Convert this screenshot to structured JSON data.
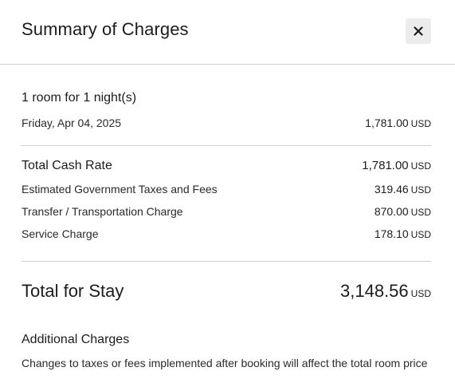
{
  "modal": {
    "title": "Summary of Charges",
    "close_icon": "close-icon"
  },
  "stay": {
    "rooms_nights": "1 room for 1 night(s)",
    "nights": [
      {
        "date": "Friday, Apr 04, 2025",
        "amount": "1,781.00",
        "currency": "USD"
      }
    ]
  },
  "charges": {
    "total_cash_rate": {
      "label": "Total Cash Rate",
      "amount": "1,781.00",
      "currency": "USD"
    },
    "items": [
      {
        "label": "Estimated Government Taxes and Fees",
        "amount": "319.46",
        "currency": "USD"
      },
      {
        "label": "Transfer / Transportation Charge",
        "amount": "870.00",
        "currency": "USD"
      },
      {
        "label": "Service Charge",
        "amount": "178.10",
        "currency": "USD"
      }
    ]
  },
  "total": {
    "label": "Total for Stay",
    "amount": "3,148.56",
    "currency": "USD"
  },
  "additional": {
    "heading": "Additional Charges",
    "note": "Changes to taxes or fees implemented after booking will affect the total room price"
  },
  "colors": {
    "text": "#1c1c1c",
    "divider": "#cfcfcf",
    "close_bg": "#ececec"
  }
}
